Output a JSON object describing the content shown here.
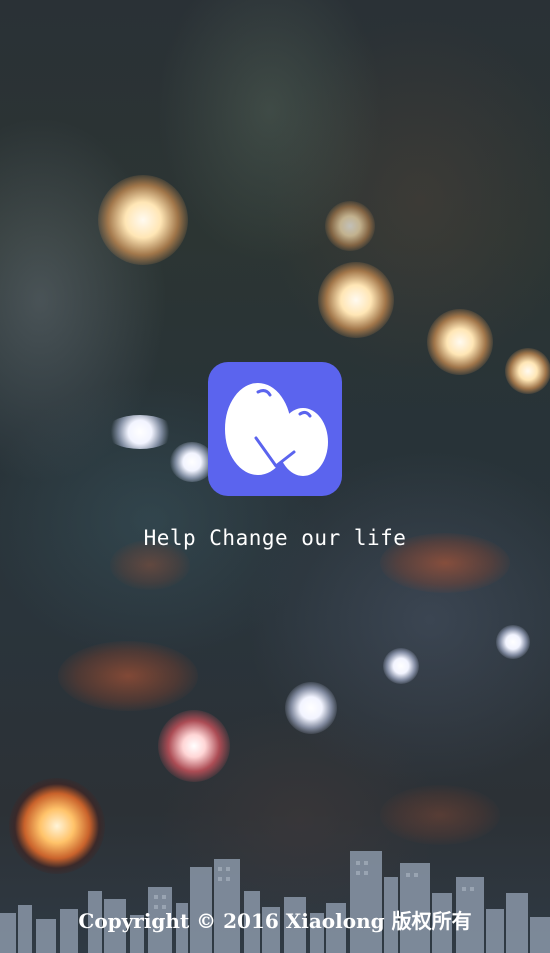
{
  "splash": {
    "tagline": "Help Change our life",
    "copyright": "Copyright © 2016 Xiaolong 版权所有"
  },
  "logo": {
    "icon": "twin-eggs-logo-icon",
    "background_color": "#5b64ee"
  },
  "background": {
    "style": "blurred city night bokeh",
    "footer_art": "city-skyline-silhouette"
  }
}
